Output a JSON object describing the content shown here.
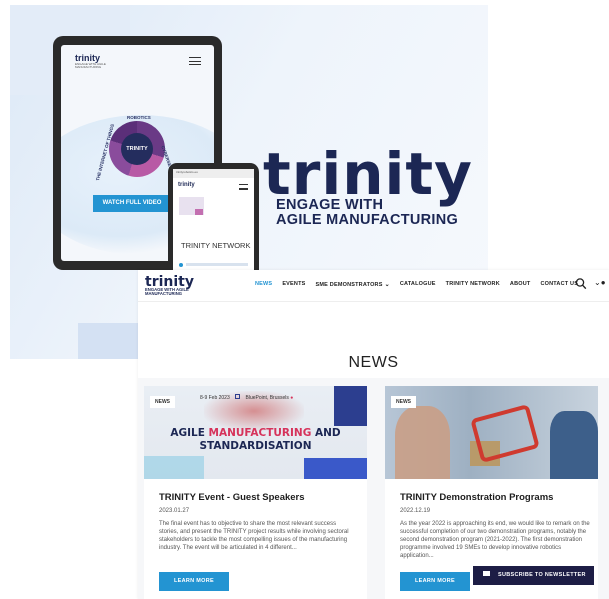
{
  "hero": {
    "logo": "trinity",
    "tagline_1": "ENGAGE WITH",
    "tagline_2": "AGILE MANUFACTURING",
    "tablet": {
      "logo": "trinity",
      "logo_sub": "ENGAGE WITH AGILE MANUFACTURING",
      "wheel_center": "TRINITY",
      "wheel_labels": [
        "ROBOTICS",
        "CYBERSECURITY",
        "THE INTERNET OF THINGS"
      ],
      "button": "WATCH FULL VIDEO"
    },
    "phone": {
      "address": "trinityrobotics.eu",
      "logo": "trinity",
      "title": "TRINITY NETWORK"
    }
  },
  "site": {
    "logo": "trinity",
    "logo_sub": "ENGAGE WITH AGILE MANUFACTURING",
    "nav": [
      {
        "label": "NEWS",
        "active": true
      },
      {
        "label": "EVENTS",
        "active": false
      },
      {
        "label": "SME DEMONSTRATORS",
        "active": false,
        "has_dropdown": true
      },
      {
        "label": "CATALOGUE",
        "active": false
      },
      {
        "label": "TRINITY NETWORK",
        "active": false
      },
      {
        "label": "ABOUT",
        "active": false
      },
      {
        "label": "CONTACT US",
        "active": false
      }
    ],
    "page_title": "NEWS",
    "cards": [
      {
        "badge": "NEWS",
        "image_event_date": "8-9 Feb 2023",
        "image_event_location": "BluePoint, Brussels",
        "image_headline_1": "AGILE",
        "image_headline_highlight": "MANUFACTURING",
        "image_headline_2": "AND",
        "image_headline_3": "STANDARDISATION",
        "title": "TRINITY Event - Guest Speakers",
        "date": "2023.01.27",
        "excerpt": "The final event has to objective to share the most relevant success stories, and present the TRINITY project results while involving sectoral stakeholders to tackle the most compelling issues of the manufacturing industry. The event will be articulated in 4 different...",
        "button": "LEARN MORE"
      },
      {
        "badge": "NEWS",
        "title": "TRINITY Demonstration Programs",
        "date": "2022.12.19",
        "excerpt": "As the year 2022 is approaching its end, we would like to remark on the successful completion of our two demonstration programs, notably the second demonstration program (2021-2022). The first demonstration programme involved 19 SMEs to develop innovative robotics application...",
        "button": "LEARN MORE"
      }
    ],
    "subscribe": "SUBSCRIBE TO NEWSLETTER"
  },
  "colors": {
    "brand_navy": "#1c2754",
    "accent_blue": "#2394d2",
    "accent_magenta": "#d6335b",
    "subscribe_bg": "#1d1d45"
  }
}
